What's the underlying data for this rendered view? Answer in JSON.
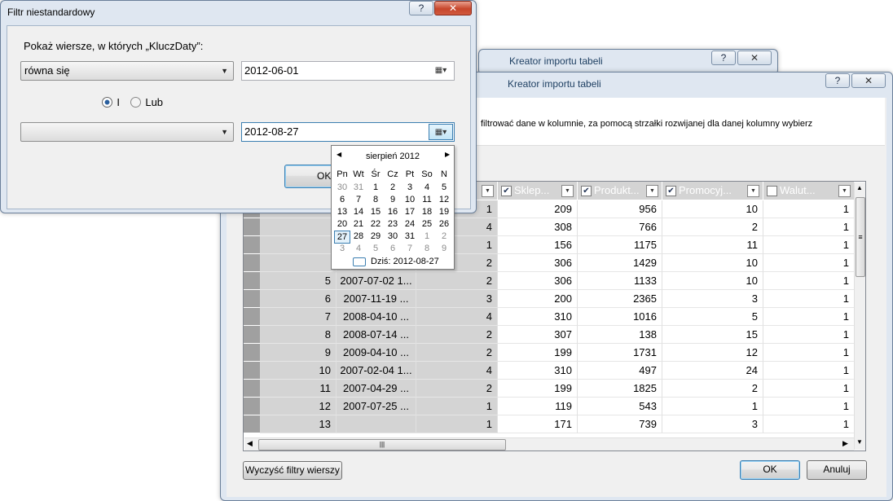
{
  "back_window": {
    "title": "Kreator importu tabeli",
    "help_btn": "?",
    "close_btn": "✕"
  },
  "main_window": {
    "title": "Kreator importu tabeli",
    "help_btn": "?",
    "close_btn": "✕",
    "instruction": "filtrować dane w kolumnie, za pomocą strzałki rozwijanej dla danej kolumny wybierz",
    "clear_filters_btn": "Wyczyść filtry wierszy",
    "ok_btn": "OK",
    "cancel_btn": "Anuluj"
  },
  "table": {
    "columns": [
      {
        "label": "Sklep...",
        "checked": true
      },
      {
        "label": "Produkt...",
        "checked": true
      },
      {
        "label": "Promocyj...",
        "checked": true
      },
      {
        "label": "Walut...",
        "checked": false
      }
    ],
    "rows": [
      {
        "id": "",
        "date": "",
        "a": "1",
        "store": "209",
        "product": "956",
        "promo": "10",
        "cur": "1"
      },
      {
        "id": "",
        "date": "",
        "a": "4",
        "store": "308",
        "product": "766",
        "promo": "2",
        "cur": "1"
      },
      {
        "id": "",
        "date": "",
        "a": "1",
        "store": "156",
        "product": "1175",
        "promo": "11",
        "cur": "1"
      },
      {
        "id": "",
        "date": "",
        "a": "2",
        "store": "306",
        "product": "1429",
        "promo": "10",
        "cur": "1"
      },
      {
        "id": "5",
        "date": "2007-07-02 1...",
        "a": "2",
        "store": "306",
        "product": "1133",
        "promo": "10",
        "cur": "1"
      },
      {
        "id": "6",
        "date": "2007-11-19 ...",
        "a": "3",
        "store": "200",
        "product": "2365",
        "promo": "3",
        "cur": "1"
      },
      {
        "id": "7",
        "date": "2008-04-10 ...",
        "a": "4",
        "store": "310",
        "product": "1016",
        "promo": "5",
        "cur": "1"
      },
      {
        "id": "8",
        "date": "2008-07-14 ...",
        "a": "2",
        "store": "307",
        "product": "138",
        "promo": "15",
        "cur": "1"
      },
      {
        "id": "9",
        "date": "2009-04-10 ...",
        "a": "2",
        "store": "199",
        "product": "1731",
        "promo": "12",
        "cur": "1"
      },
      {
        "id": "10",
        "date": "2007-02-04 1...",
        "a": "4",
        "store": "310",
        "product": "497",
        "promo": "24",
        "cur": "1"
      },
      {
        "id": "11",
        "date": "2007-04-29 ...",
        "a": "2",
        "store": "199",
        "product": "1825",
        "promo": "2",
        "cur": "1"
      },
      {
        "id": "12",
        "date": "2007-07-25 ...",
        "a": "1",
        "store": "119",
        "product": "543",
        "promo": "1",
        "cur": "1"
      },
      {
        "id": "13",
        "date": "",
        "a": "1",
        "store": "171",
        "product": "739",
        "promo": "3",
        "cur": "1"
      }
    ]
  },
  "filter_dialog": {
    "title": "Filtr niestandardowy",
    "help_btn": "?",
    "close_btn": "✕",
    "prompt": "Pokaż wiersze, w których „KluczDaty”:",
    "operator1": "równa się",
    "value1": "2012-06-01",
    "and_label": "I",
    "or_label": "Lub",
    "operator2": "",
    "value2": "2012-08-27",
    "ok_btn": "OK",
    "and_selected": true
  },
  "calendar": {
    "month_label": "sierpień 2012",
    "prev": "◀",
    "next": "▶",
    "weekdays": [
      "Pn",
      "Wt",
      "Śr",
      "Cz",
      "Pt",
      "So",
      "N"
    ],
    "weeks": [
      [
        "30",
        "31",
        "1",
        "2",
        "3",
        "4",
        "5"
      ],
      [
        "6",
        "7",
        "8",
        "9",
        "10",
        "11",
        "12"
      ],
      [
        "13",
        "14",
        "15",
        "16",
        "17",
        "18",
        "19"
      ],
      [
        "20",
        "21",
        "22",
        "23",
        "24",
        "25",
        "26"
      ],
      [
        "27",
        "28",
        "29",
        "30",
        "31",
        "1",
        "2"
      ],
      [
        "3",
        "4",
        "5",
        "6",
        "7",
        "8",
        "9"
      ]
    ],
    "selected_day": "27",
    "today_label": "Dziś: 2012-08-27"
  },
  "colors": {
    "frame": "#dfe7f1",
    "accent": "#3c7fb1",
    "header_gray": "#d4d4d4"
  }
}
